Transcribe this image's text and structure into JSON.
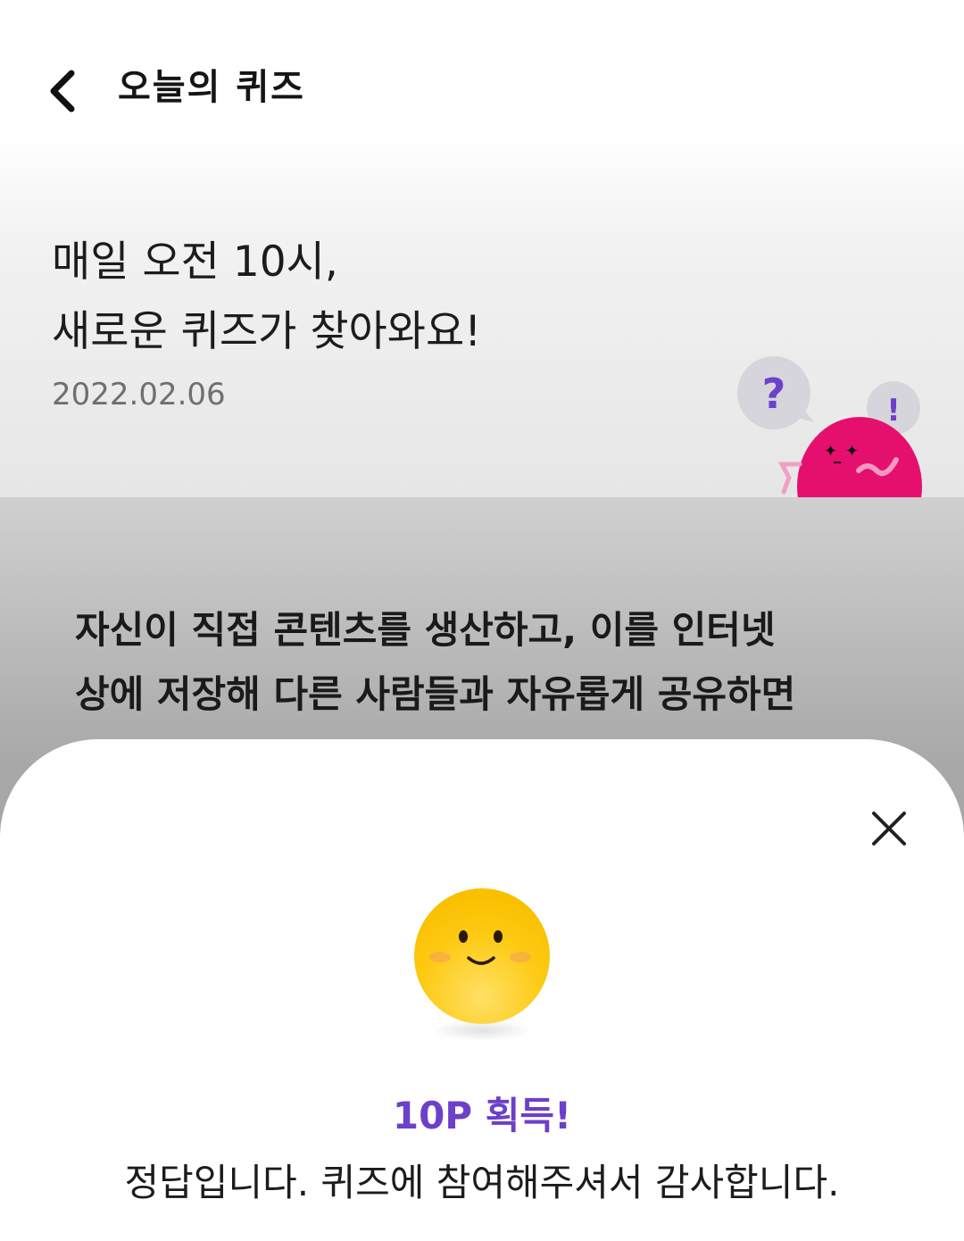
{
  "header": {
    "title": "오늘의 퀴즈"
  },
  "hero": {
    "line1": "매일 오전 10시,",
    "line2": "새로운 퀴즈가 찾아와요!",
    "date": "2022.02.06",
    "bubble_question": "?",
    "bubble_exclaim": "!"
  },
  "quiz": {
    "line1": "자신이 직접 콘텐츠를 생산하고, 이를 인터넷",
    "line2": "상에 저장해 다른 사람들과 자유롭게 공유하면"
  },
  "result": {
    "points": "10P 획득!",
    "message": "정답입니다. 퀴즈에 참여해주셔서 감사합니다."
  },
  "colors": {
    "accent": "#6d40c9",
    "mascot": "#e5106e",
    "emoji": "#fcc400"
  }
}
